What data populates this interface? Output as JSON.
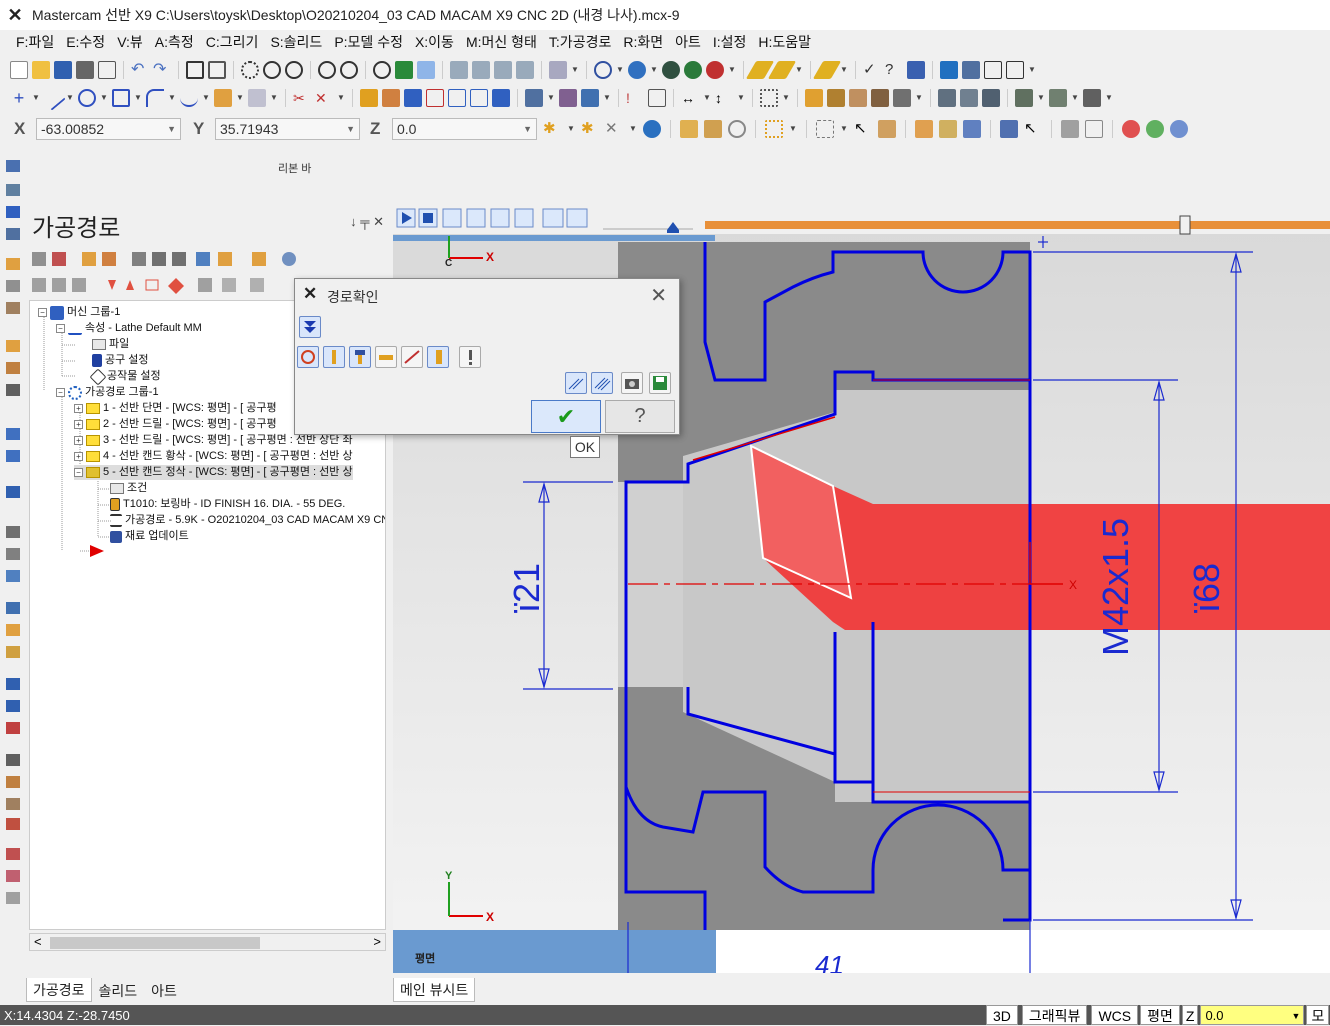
{
  "app": {
    "title": "Mastercam 선반 X9  C:\\Users\\toysk\\Desktop\\O20210204_03 CAD MACAM X9 CNC 2D (내경 나사).mcx-9"
  },
  "menu": [
    "F:파일",
    "E:수정",
    "V:뷰",
    "A:측정",
    "C:그리기",
    "S:솔리드",
    "P:모델 수정",
    "X:이동",
    "M:머신 형태",
    "T:가공경로",
    "R:화면",
    "아트",
    "I:설정",
    "H:도움말"
  ],
  "coords": {
    "x_label": "X",
    "x_value": "-63.00852",
    "y_label": "Y",
    "y_value": "35.71943",
    "z_label": "Z",
    "z_value": "0.0"
  },
  "ribbon_label": "리본 바",
  "panel": {
    "title": "가공경로",
    "pin": "↓ ╤ ✕"
  },
  "tree": {
    "machine_group": "머신 그룹-1",
    "props": "속성 - Lathe Default MM",
    "file": "파일",
    "tool_settings": "공구 설정",
    "stock_settings": "공작물 설정",
    "toolpath_group": "가공경로 그룹-1",
    "ops": [
      "1 - 선반 단면 - [WCS: 평면] - [  공구평",
      "2 - 선반 드릴 - [WCS: 평면] - [  공구평",
      "3 - 선반 드릴 - [WCS: 평면] - [  공구평면  : 선반 상단 좌",
      "4 - 선반 캔드 황삭 - [WCS: 평면] - [  공구평면  : 선반 상",
      "5 - 선반 캔드 정삭 - [WCS: 평면] - [  공구평면  : 선반 상"
    ],
    "sub_params": "조건",
    "sub_tool": "T1010: 보링바 - ID FINISH 16. DIA. - 55 DEG.",
    "sub_path": "가공경로 - 5.9K - O20210204_03 CAD MACAM X9 CN",
    "sub_stock": "재료 업데이트"
  },
  "panel_tabs": [
    "가공경로",
    "솔리드",
    "아트"
  ],
  "view_tabs": [
    "메인 뷰시트"
  ],
  "dialog": {
    "title": "경로확인",
    "ok_tip": "OK"
  },
  "viewport": {
    "plane_label": "평면",
    "axis_c": "C",
    "axis_x": "X",
    "axis_y": "Y",
    "dim_21": "ï21",
    "dim_68": "ï68",
    "dim_m42": "M42x1.5",
    "dim_41": "41"
  },
  "status": {
    "coords": "X:14.4304   Z:-28.7450",
    "btn_3d": "3D",
    "btn_graphic": "그래픽뷰",
    "btn_wcs": "WCS",
    "btn_plane": "평면",
    "z_label": "Z",
    "z_value": "0.0",
    "extra": "모"
  },
  "colors": {
    "blue_geom": "#0000e0",
    "red_tool": "#f03a3a",
    "gray_stock": "#8a8a8a",
    "timeline_orange": "#e8903a"
  }
}
